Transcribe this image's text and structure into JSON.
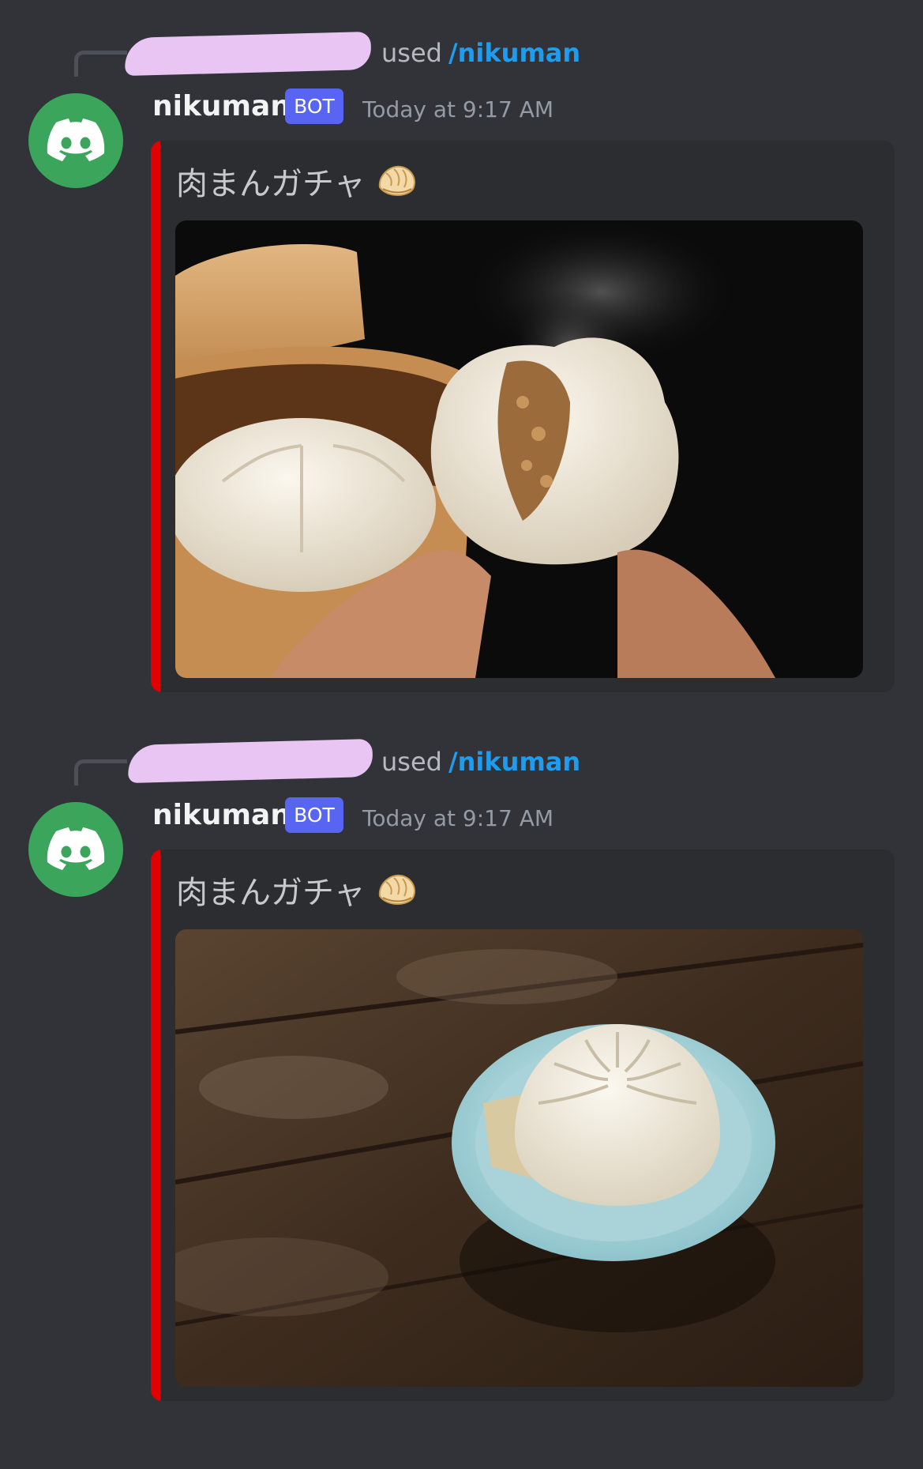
{
  "messages": [
    {
      "reply_used": "used",
      "reply_command": "/nikuman",
      "username": "nikuman",
      "bot_tag": "BOT",
      "timestamp": "Today at 9:17 AM",
      "embed_title": "肉まんガチャ",
      "embed_emoji": "dumpling-icon",
      "image_subject": "nikuman-steamer-photo"
    },
    {
      "reply_used": "used",
      "reply_command": "/nikuman",
      "username": "nikuman",
      "bot_tag": "BOT",
      "timestamp": "Today at 9:17 AM",
      "embed_title": "肉まんガチャ",
      "embed_emoji": "dumpling-icon",
      "image_subject": "xiaolongbao-bowl-photo"
    }
  ],
  "colors": {
    "background": "#313338",
    "embed_background": "#2b2d31",
    "embed_accent": "#e00000",
    "command_link": "#1e9cf0",
    "bot_tag": "#5865f2",
    "avatar": "#3ba55c"
  }
}
